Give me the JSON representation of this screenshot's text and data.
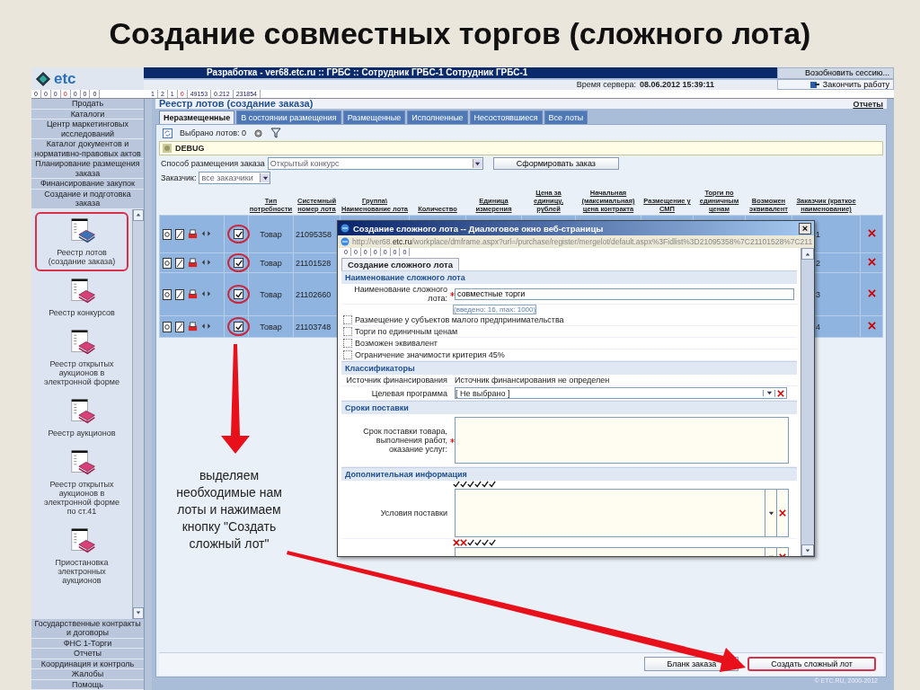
{
  "slide_title": "Создание совместных торгов (сложного лота)",
  "app": {
    "logo": "etc",
    "header_title": "Разработка - ver68.etc.ru :: ГРБС :: Сотрудник ГРБС-1 Сотрудник ГРБС-1",
    "server_time_label": "Время сервера:",
    "server_time": "08.06.2012 15:39:11",
    "session_buttons": [
      "Возобновить сессию...",
      "Закончить работу"
    ],
    "counters_left": [
      {
        "value": "0",
        "alert": false
      },
      {
        "value": "0",
        "alert": false
      },
      {
        "value": "0",
        "alert": false
      },
      {
        "value": "0",
        "alert": true
      },
      {
        "value": "0",
        "alert": false
      },
      {
        "value": "0",
        "alert": false
      },
      {
        "value": "0",
        "alert": false
      }
    ],
    "counters_right": [
      {
        "value": "1",
        "alert": false
      },
      {
        "value": "2",
        "alert": false
      },
      {
        "value": "1",
        "alert": false
      },
      {
        "value": "0",
        "alert": true
      },
      {
        "value": "49153",
        "alert": false
      },
      {
        "value": "0.212",
        "alert": false
      },
      {
        "value": "231854",
        "alert": false
      }
    ]
  },
  "sidebar": {
    "menu_top": [
      "Продать",
      "Каталоги",
      "Центр маркетинговых исследований",
      "Каталог документов и нормативно-правовых актов",
      "Планирование размещения заказа",
      "Финансирование закупок",
      "Создание и подготовка заказа"
    ],
    "registry_items": [
      {
        "label": "Реестр лотов (создание заказа)",
        "selected": true
      },
      {
        "label": "Реестр конкурсов",
        "selected": false
      },
      {
        "label": "Реестр открытых аукционов в электронной форме",
        "selected": false
      },
      {
        "label": "Реестр аукционов",
        "selected": false
      },
      {
        "label": "Реестр открытых аукционов в электронной форме по ст.41",
        "selected": false
      },
      {
        "label": "Приостановка электронных аукционов",
        "selected": false
      }
    ],
    "menu_bottom": [
      "Государственные контракты и договоры",
      "ФНС 1-Торги",
      "Отчеты",
      "Координация и контроль",
      "Жалобы",
      "Помощь"
    ]
  },
  "main": {
    "breadcrumb": "Реестр лотов (создание заказа)",
    "reports_link": "Отчеты",
    "tabs": [
      {
        "label": "Неразмещенные",
        "selected": true
      },
      {
        "label": "В состоянии размещения",
        "selected": false
      },
      {
        "label": "Размещенные",
        "selected": false
      },
      {
        "label": "Исполненные",
        "selected": false
      },
      {
        "label": "Несостоявшиеся",
        "selected": false
      },
      {
        "label": "Все лоты",
        "selected": false
      }
    ],
    "selected_count": "Выбрано лотов: 0",
    "debug": "DEBUG",
    "method_label": "Способ размещения заказа",
    "method_value": "Открытый конкурс",
    "form_button": "Сформировать заказ",
    "customer_label": "Заказчик:",
    "customer_value": "все заказчики",
    "columns": [
      "Тип потребности",
      "Системный номер лота",
      "Группа\\ Наименование лота",
      "Количество",
      "Единица измерения",
      "Цена за единицу, рублей",
      "Начальная (максимальная) цена контракта",
      "Размещение у СМП",
      "Торги по единичным ценам",
      "Возможен эквивалент",
      "Заказчик (краткое наименование)"
    ],
    "rows": [
      {
        "type": "Товар",
        "lot_number": "21095358",
        "column_11": "1",
        "checked": true,
        "selected": true
      },
      {
        "type": "Товар",
        "lot_number": "21101528",
        "column_11": "2",
        "checked": true,
        "selected": true
      },
      {
        "type": "Товар",
        "lot_number": "21102660",
        "column_11": "3",
        "checked": true,
        "selected": true
      },
      {
        "type": "Товар",
        "lot_number": "21103748",
        "column_11": "4",
        "checked": true,
        "selected": true
      }
    ],
    "buttons": [
      {
        "label": "Бланк заказа",
        "highlighted": false
      },
      {
        "label": "Создать сложный лот",
        "highlighted": true
      }
    ],
    "footer": "© ETC.RU, 2000-2012"
  },
  "dialog": {
    "title": "Создание сложного лота -- Диалоговое окно веб-страницы",
    "close": "×",
    "url_prefix": "http://ver68.",
    "url_domain": "etc.ru",
    "url_rest": "/workplace/dmframe.aspx?url=/purchase/register/mergelot/default.aspx%3Fidlist%3D21095358%7C21101528%7C211",
    "counters": [
      "0",
      "0",
      "0",
      "0",
      "0",
      "0",
      "0"
    ],
    "tab": "Создание сложного лота",
    "sections": [
      {
        "title": "Наименование сложного лота",
        "fields": [
          {
            "kind": "text",
            "label": "Наименование сложного лота:",
            "required": true,
            "value": "совместные торги",
            "hint": "(введено: 16, max: 1000)"
          },
          {
            "kind": "checkbox",
            "label": "Размещение у субъектов малого предпринимательства",
            "checked": false
          },
          {
            "kind": "checkbox",
            "label": "Торги по единичным ценам",
            "checked": false
          },
          {
            "kind": "checkbox",
            "label": "Возможен эквивалент",
            "checked": false
          },
          {
            "kind": "checkbox",
            "label": "Ограничение значимости критерия 45%",
            "checked": false
          }
        ]
      },
      {
        "title": "Классификаторы",
        "fields": [
          {
            "kind": "static",
            "label": "Источник финансирования",
            "value": "Источник финансирования не определен"
          },
          {
            "kind": "select",
            "label": "Целевая программа",
            "value": "[ Не выбрано ]"
          }
        ]
      },
      {
        "title": "Сроки поставки",
        "fields": [
          {
            "kind": "textarea",
            "label": "Срок поставки товара, выполнения работ, оказание услуг:",
            "required": true
          }
        ]
      },
      {
        "title": "Дополнительная информация",
        "fields": [
          {
            "kind": "memo",
            "label": "Условия поставки",
            "marks": [
              true,
              true,
              true,
              true,
              true,
              true
            ]
          },
          {
            "kind": "memo",
            "marks": [
              false,
              false,
              true,
              true,
              true,
              true
            ]
          }
        ]
      }
    ]
  },
  "annotation": "выделяем необходимые нам лоты и нажимаем кнопку \"Создать сложный лот\""
}
